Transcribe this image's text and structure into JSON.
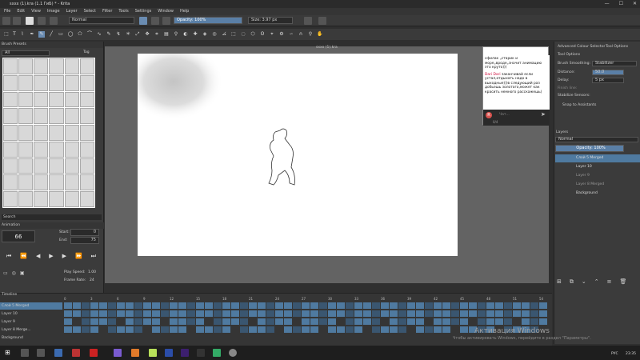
{
  "window": {
    "title": "sxxx (1).kra (1.1 ГиБ) * - Krita",
    "min": "—",
    "max": "☐",
    "close": "✕"
  },
  "menu": [
    "File",
    "Edit",
    "View",
    "Image",
    "Layer",
    "Select",
    "Filter",
    "Tools",
    "Settings",
    "Window",
    "Help"
  ],
  "toolbar": {
    "blend_mode": "Normal",
    "opacity": "Opacity: 100%",
    "size": "Size: 3.97 px"
  },
  "brush_presets": {
    "title": "Brush Presets",
    "filter": "All",
    "tag": "Tag"
  },
  "search_label": "Search",
  "animation": {
    "title": "Animation",
    "frame": "66",
    "start_label": "Start:",
    "start": "0",
    "end_label": "End:",
    "end": "75",
    "play_speed_label": "Play Speed:",
    "play_speed": "1.00",
    "frame_rate_label": "Frame Rate:",
    "frame_rate": "24"
  },
  "document_tab": "sxxx (1).kra",
  "chat": {
    "msg1": "сфилак „старик и море„вроде„значит анимацию это круто)))",
    "user2": "Dari Dari",
    "msg2": "заканчивай если устал,отдыхать надо в выходные)))в следующий раз добьешь золотого,может как красить немного расскажешь)",
    "placeholder": "Чат...",
    "count": "0/4",
    "badge": "R"
  },
  "right_tabs": {
    "a": "Advanced Colour Selector",
    "b": "Tool Options"
  },
  "tool_options": {
    "title": "Tool Options",
    "brush_smoothing_label": "Brush Smoothing:",
    "brush_smoothing": "Stabilizer",
    "distance_label": "Distance:",
    "distance": "50.0",
    "delay_label": "Delay:",
    "delay": "5 px",
    "finish_label": "Finish line:",
    "stabilize_label": "Stabilize Sensors:",
    "snap_label": "Snap to Assistants"
  },
  "layers": {
    "title": "Layers",
    "blend": "Normal",
    "opacity": "Opacity: 100%",
    "items": [
      "Слой 5 Merged",
      "Layer 10",
      "Layer 9",
      "Layer 8 Merged",
      "Background"
    ]
  },
  "timeline": {
    "title": "Timeline",
    "rows": [
      "Слой 5 Merged",
      "Layer 10",
      "Layer 9",
      "Layer 8 Merge...",
      "Background"
    ],
    "ticks": [
      "0",
      "3",
      "6",
      "9",
      "12",
      "15",
      "18",
      "21",
      "24",
      "27",
      "30",
      "33",
      "36",
      "39",
      "42",
      "45",
      "48",
      "51",
      "54"
    ]
  },
  "watermark": {
    "line1": "Активация Windows",
    "line2": "Чтобы активировать Windows, перейдите в раздел \"Параметры\"."
  },
  "tray": {
    "lang": "РУС",
    "time": "23:35"
  }
}
